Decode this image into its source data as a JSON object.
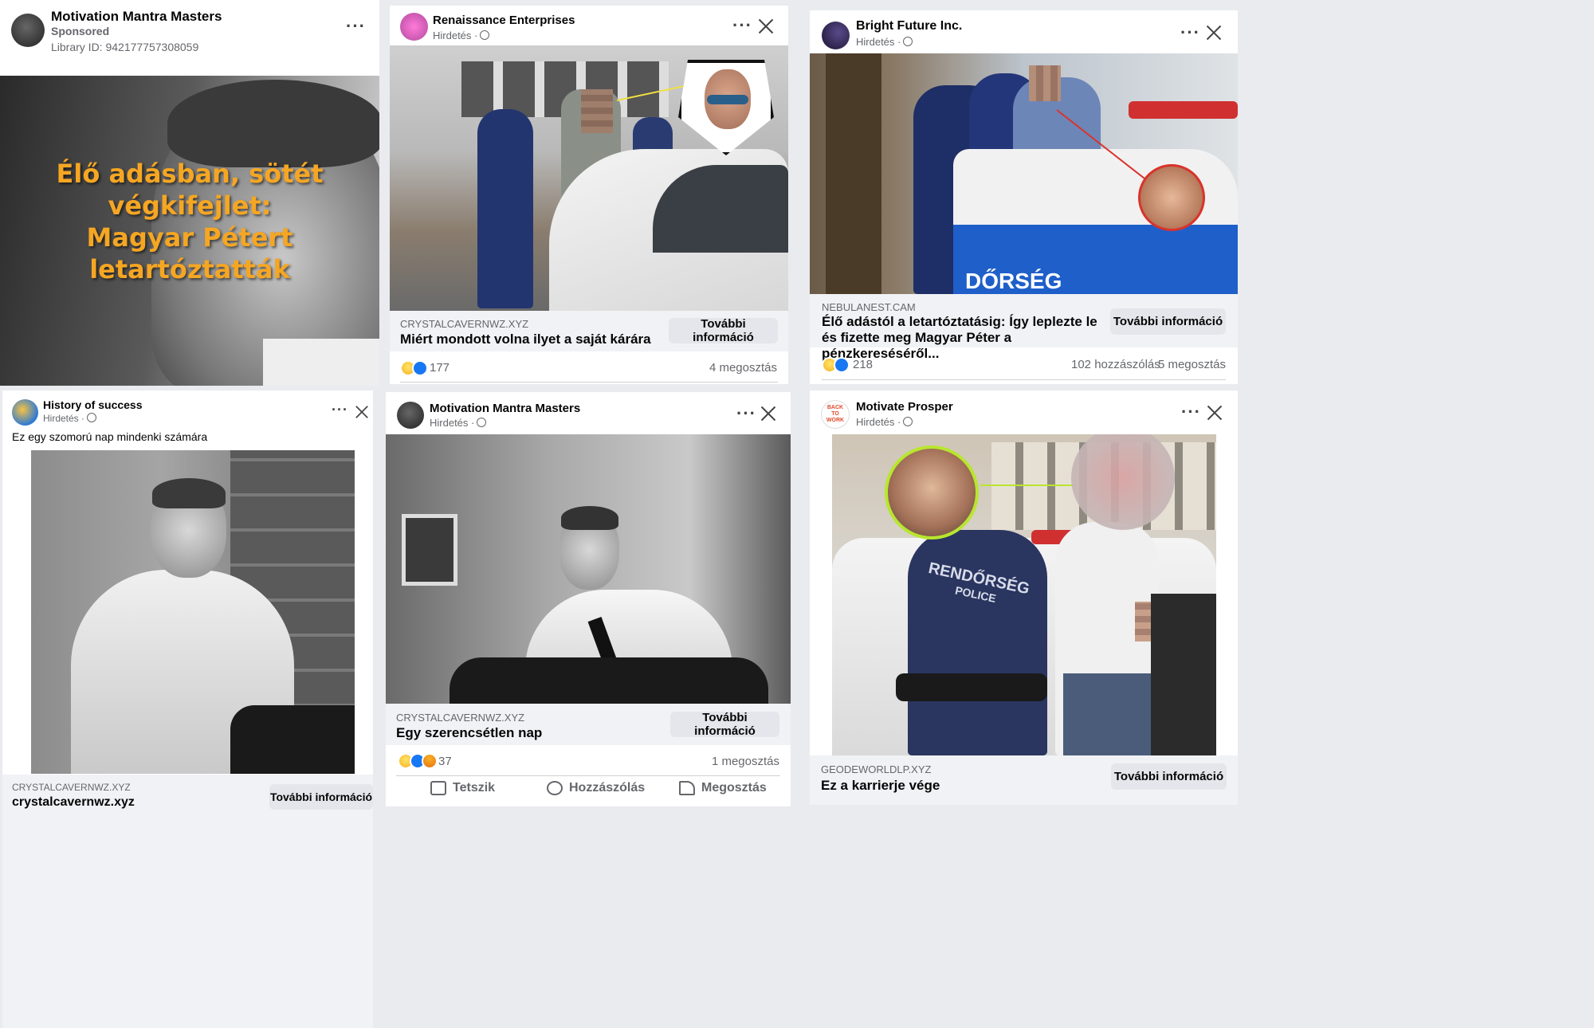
{
  "cards": [
    {
      "page": "Motivation Mantra Masters",
      "label": "Sponsored",
      "library": "Library ID: 942177757308059",
      "overlay_line1": "Élő adásban, sötét végkifejlet:",
      "overlay_line2": "Magyar Pétert letartóztatták"
    },
    {
      "page": "Renaissance Enterprises",
      "label": "Hirdetés ·",
      "domain": "CRYSTALCAVERNWZ.XYZ",
      "headline": "Miért mondott volna ilyet a saját kárára",
      "cta": "További információ",
      "reactions": "177",
      "shares": "4 megosztás"
    },
    {
      "page": "Bright Future Inc.",
      "label": "Hirdetés ·",
      "domain": "NEBULANEST.CAM",
      "headline": "Élő adástól a letartóztatásig: Így leplezte le és fizette meg Magyar Péter a pénzkereséséről...",
      "cta": "További információ",
      "reactions": "218",
      "comments": "102 hozzászólás",
      "shares": "5 megosztás",
      "van_text": "DŐRSÉG"
    },
    {
      "page": "History of success",
      "label": "Hirdetés ·",
      "caption": "Ez egy szomorú nap mindenki számára",
      "domain": "CRYSTALCAVERNWZ.XYZ",
      "headline": "crystalcavernwz.xyz",
      "cta": "További információ"
    },
    {
      "page": "Motivation Mantra Masters",
      "label": "Hirdetés ·",
      "domain": "CRYSTALCAVERNWZ.XYZ",
      "headline": "Egy szerencsétlen nap",
      "cta": "További információ",
      "reactions": "37",
      "shares": "1 megosztás",
      "like": "Tetszik",
      "comment": "Hozzászólás",
      "share": "Megosztás"
    },
    {
      "page": "Motivate Prosper",
      "label": "Hirdetés ·",
      "domain": "GEODEWORLDLP.XYZ",
      "headline": "Ez a karrierje vége",
      "cta": "További információ",
      "shirt_line1": "RENDŐRSÉG",
      "shirt_line2": "POLICE",
      "avatar_text": "BACK TO WORK"
    }
  ],
  "colors": {
    "accent": "#1877f2",
    "overlay_text": "#f5a623",
    "highlight_circle": "#b8e62e",
    "red_circle": "#d9332b"
  }
}
